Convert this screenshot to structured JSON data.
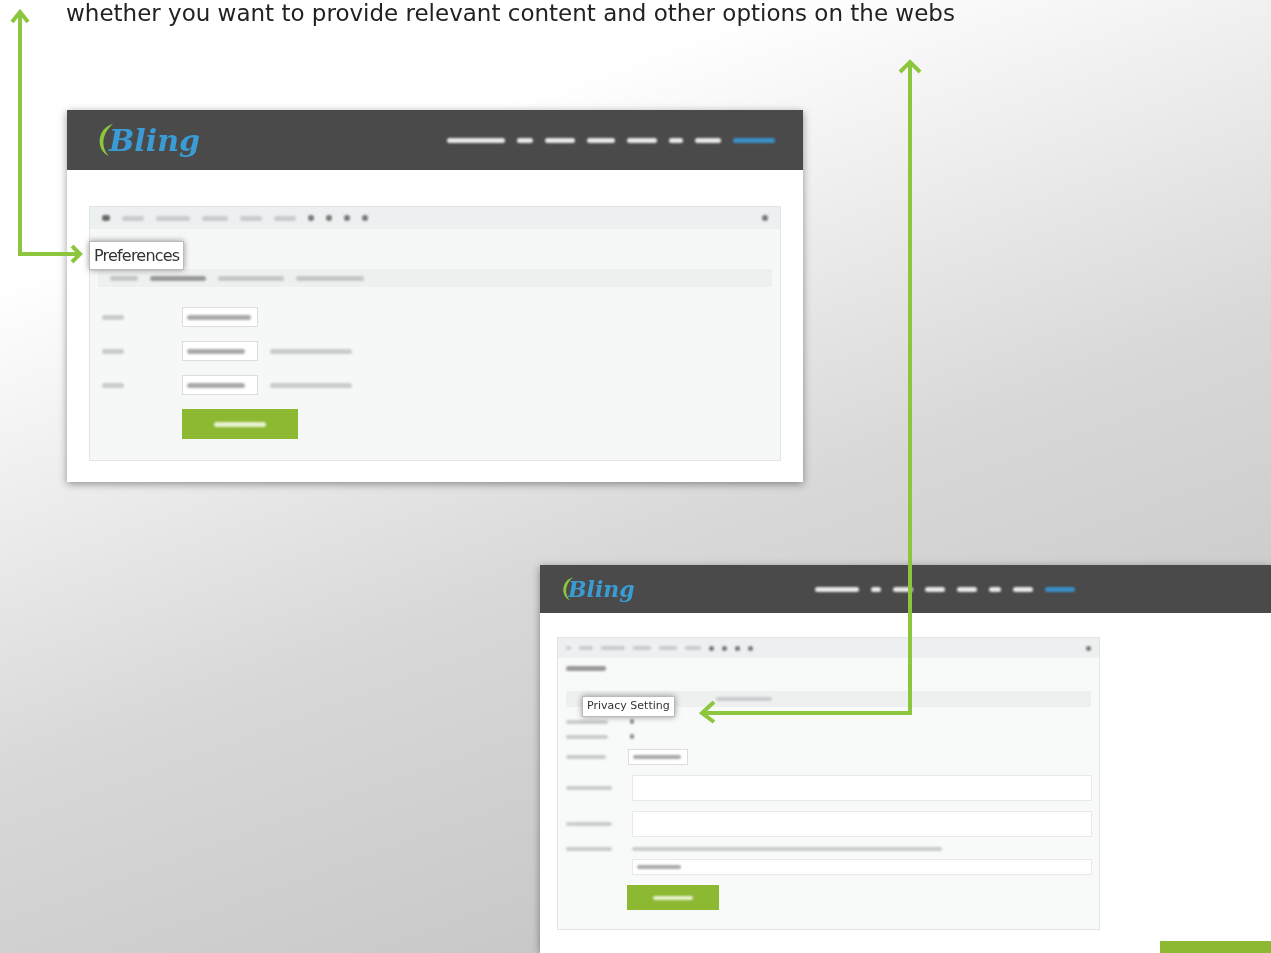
{
  "caption": "whether you want to provide relevant content and other options on the webs",
  "screenshots": [
    {
      "logo_text": "Bling",
      "callout": "Preferences"
    },
    {
      "logo_text": "Bling",
      "callout": "Privacy Setting"
    }
  ]
}
